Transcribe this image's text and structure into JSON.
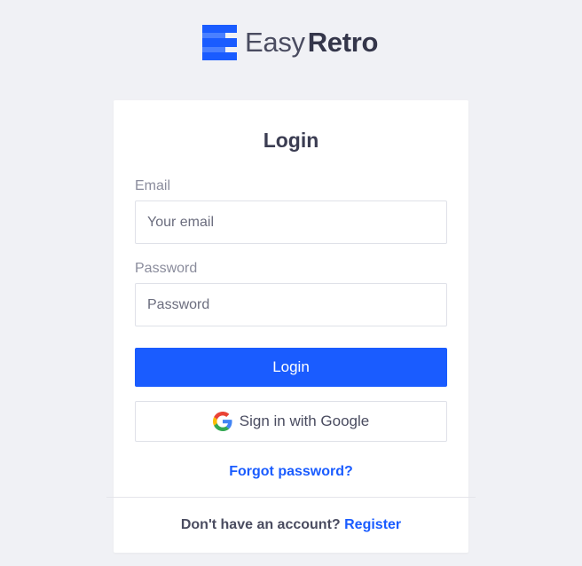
{
  "brand": {
    "name_part1": "Easy",
    "name_part2": "Retro",
    "accent": "#1a5cff",
    "logo_icon": "easyretro-logo-icon"
  },
  "login": {
    "title": "Login",
    "email_label": "Email",
    "email_placeholder": "Your email",
    "email_value": "",
    "password_label": "Password",
    "password_placeholder": "Password",
    "password_value": "",
    "login_button": "Login",
    "google_button": "Sign in with Google",
    "google_icon": "google-icon",
    "forgot_link": "Forgot password?",
    "no_account_text": "Don't have an account?",
    "register_link": "Register"
  }
}
